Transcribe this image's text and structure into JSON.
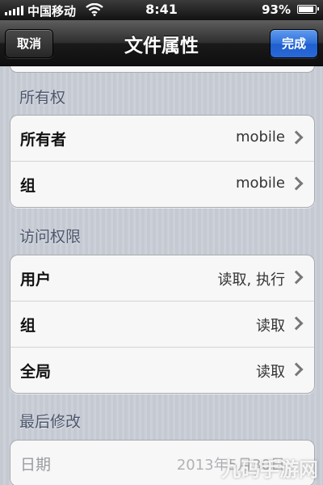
{
  "status_bar": {
    "carrier": "中国移动",
    "time": "8:41",
    "battery_percent": "93%",
    "battery_level": 0.93
  },
  "nav": {
    "title": "文件属性",
    "cancel_label": "取消",
    "done_label": "完成",
    "done_color": "#2f6fd8"
  },
  "sections": [
    {
      "title": "所有权",
      "rows": [
        {
          "label": "所有者",
          "value": "mobile"
        },
        {
          "label": "组",
          "value": "mobile"
        }
      ]
    },
    {
      "title": "访问权限",
      "rows": [
        {
          "label": "用户",
          "value": "读取, 执行"
        },
        {
          "label": "组",
          "value": "读取"
        },
        {
          "label": "全局",
          "value": "读取"
        }
      ]
    },
    {
      "title": "最后修改",
      "rows": [
        {
          "label": "日期",
          "value": "2013年5月30日"
        }
      ]
    }
  ],
  "icons": {
    "signal": "signal-bars-icon",
    "wifi": "wifi-icon",
    "battery": "battery-icon",
    "chevron": "chevron-right-icon"
  },
  "watermark": "九码手游网"
}
